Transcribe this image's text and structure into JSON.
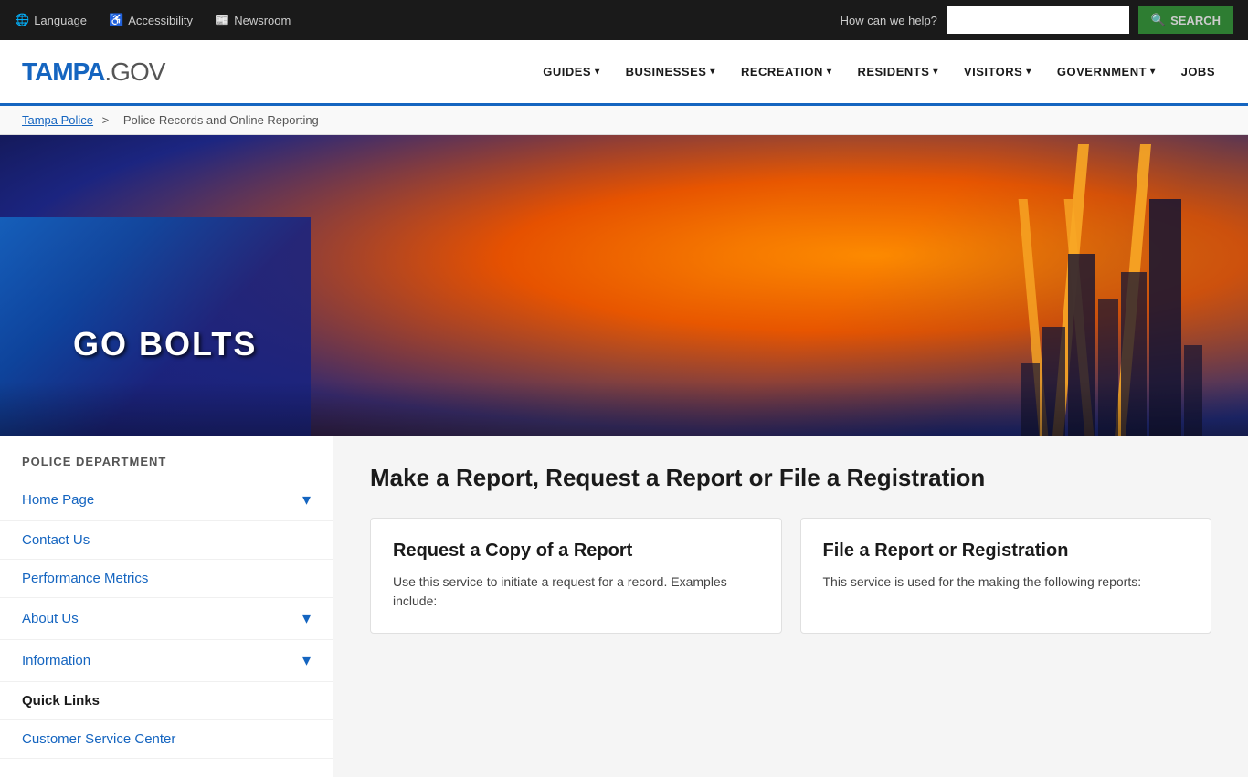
{
  "topBar": {
    "language_label": "Language",
    "accessibility_label": "Accessibility",
    "newsroom_label": "Newsroom",
    "search_prompt": "How can we help?",
    "search_placeholder": "",
    "search_button": "SEARCH"
  },
  "header": {
    "logo_tampa": "TAMPA",
    "logo_gov": ".GOV",
    "nav": [
      {
        "label": "GUIDES",
        "has_dropdown": true
      },
      {
        "label": "BUSINESSES",
        "has_dropdown": true
      },
      {
        "label": "RECREATION",
        "has_dropdown": true
      },
      {
        "label": "RESIDENTS",
        "has_dropdown": true
      },
      {
        "label": "VISITORS",
        "has_dropdown": true
      },
      {
        "label": "GOVERNMENT",
        "has_dropdown": true
      },
      {
        "label": "JOBS",
        "has_dropdown": false
      }
    ]
  },
  "breadcrumb": {
    "parent": "Tampa Police",
    "separator": ">",
    "current": "Police Records and Online Reporting"
  },
  "sidebar": {
    "section_title": "POLICE DEPARTMENT",
    "items": [
      {
        "label": "Home Page",
        "has_expand": true,
        "bold": false
      },
      {
        "label": "Contact Us",
        "has_expand": false,
        "bold": false
      },
      {
        "label": "Performance Metrics",
        "has_expand": false,
        "bold": false
      },
      {
        "label": "About Us",
        "has_expand": true,
        "bold": false
      },
      {
        "label": "Information",
        "has_expand": true,
        "bold": false
      },
      {
        "label": "Quick Links",
        "has_expand": false,
        "bold": true
      },
      {
        "label": "Customer Service Center",
        "has_expand": false,
        "bold": false
      }
    ]
  },
  "mainContent": {
    "page_title": "Make a Report, Request a Report or File a Registration",
    "cards": [
      {
        "title": "Request a Copy of a Report",
        "text": "Use this service to initiate a request for a record. Examples include:"
      },
      {
        "title": "File a Report or Registration",
        "text": "This service is used for the making the following reports:"
      }
    ]
  }
}
